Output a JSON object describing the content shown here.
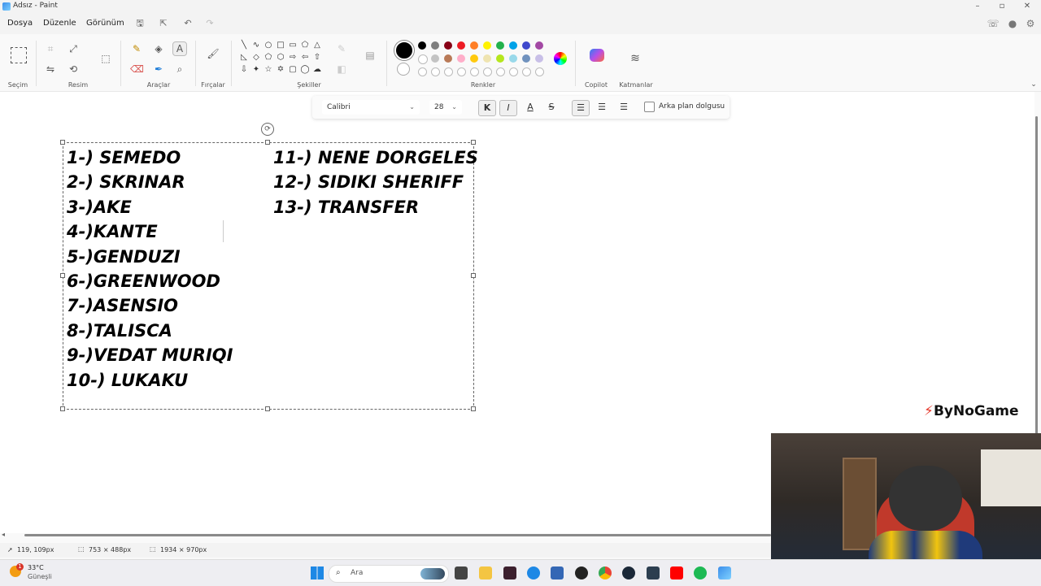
{
  "window": {
    "title": "Adsız - Paint"
  },
  "menu": {
    "file": "Dosya",
    "edit": "Düzenle",
    "view": "Görünüm"
  },
  "ribbon": {
    "groups": {
      "selection": "Seçim",
      "image": "Resim",
      "tools": "Araçlar",
      "brushes": "Fırçalar",
      "shapes": "Şekiller",
      "colors": "Renkler",
      "copilot": "Copilot",
      "layers": "Katmanlar"
    },
    "palette_row1": [
      "#000000",
      "#7f7f7f",
      "#880015",
      "#ed1c24",
      "#ff7f27",
      "#fff200",
      "#22b14c",
      "#00a2e8",
      "#3f48cc",
      "#a349a4"
    ],
    "palette_row2": [
      "#ffffff",
      "#c3c3c3",
      "#b97a57",
      "#ffaec9",
      "#ffc90e",
      "#efe4b0",
      "#b5e61d",
      "#99d9ea",
      "#7092be",
      "#c8bfe7"
    ],
    "active_color": "#000000"
  },
  "textbar": {
    "font": "Calibri",
    "size": "28",
    "bold": "K",
    "italic": "I",
    "fill_label": "Arka plan dolgusu"
  },
  "canvas_text": {
    "left_lines": [
      "1-) SEMEDO",
      "2-) SKRINAR",
      "3-)AKE",
      "4-)KANTE",
      "5-)GENDUZI",
      "6-)GREENWOOD",
      "7-)ASENSIO",
      "8-)TALISCA",
      "9-)VEDAT MURIQI",
      "10-) LUKAKU"
    ],
    "right_lines": [
      "11-) NENE DORGELES",
      "12-) SIDIKI SHERIFF",
      "13-) TRANSFER"
    ]
  },
  "statusbar": {
    "cursor": "119, 109px",
    "selection": "753 × 488px",
    "canvas": "1934 × 970px"
  },
  "taskbar": {
    "temp": "33°C",
    "weather": "Güneşli",
    "search_placeholder": "Ara",
    "weather_badge": "1"
  },
  "overlay": {
    "logo": "ByNoGame"
  }
}
